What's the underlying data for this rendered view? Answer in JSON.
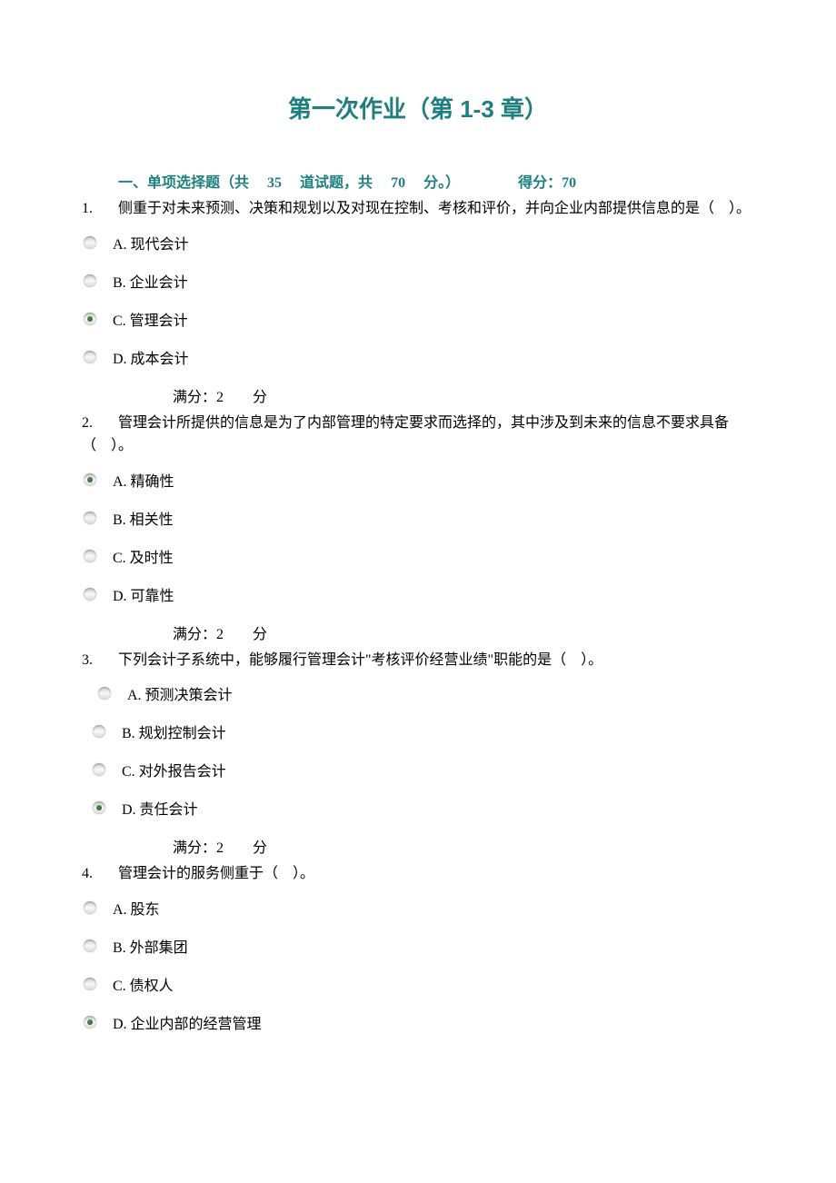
{
  "title": "第一次作业（第 1-3 章）",
  "section_header_prefix": "一、单项选择题（共",
  "section_count": "35",
  "section_mid": "道试题，共",
  "section_points": "70",
  "section_suffix": "分。）",
  "score_label": "得分：",
  "score_value": "70",
  "questions": [
    {
      "num": "1.",
      "text": "侧重于对未来预测、决策和规划以及对现在控制、考核和评价，并向企业内部提供信息的是（　）。",
      "options": [
        {
          "label": "A. 现代会计",
          "checked": false
        },
        {
          "label": "B. 企业会计",
          "checked": false
        },
        {
          "label": "C. 管理会计",
          "checked": true
        },
        {
          "label": "D. 成本会计",
          "checked": false
        }
      ],
      "full_score": "满分：2　　分"
    },
    {
      "num": "2.",
      "text": "管理会计所提供的信息是为了内部管理的特定要求而选择的，其中涉及到未来的信息不要求具备（　）。",
      "options": [
        {
          "label": "A. 精确性",
          "checked": true
        },
        {
          "label": "B. 相关性",
          "checked": false
        },
        {
          "label": "C. 及时性",
          "checked": false
        },
        {
          "label": "D. 可靠性",
          "checked": false
        }
      ],
      "full_score": "满分：2　　分"
    },
    {
      "num": "3.",
      "text": "下列会计子系统中，能够履行管理会计\"考核评价经营业绩\"职能的是（　）。",
      "options": [
        {
          "label": "A. 预测决策会计",
          "checked": false
        },
        {
          "label": "B. 规划控制会计",
          "checked": false
        },
        {
          "label": "C. 对外报告会计",
          "checked": false
        },
        {
          "label": "D. 责任会计",
          "checked": true
        }
      ],
      "full_score": "满分：2　　分"
    },
    {
      "num": "4.",
      "text": "管理会计的服务侧重于（　）。",
      "options": [
        {
          "label": "A. 股东",
          "checked": false
        },
        {
          "label": "B. 外部集团",
          "checked": false
        },
        {
          "label": "C. 债权人",
          "checked": false
        },
        {
          "label": "D. 企业内部的经营管理",
          "checked": true
        }
      ],
      "full_score": ""
    }
  ]
}
